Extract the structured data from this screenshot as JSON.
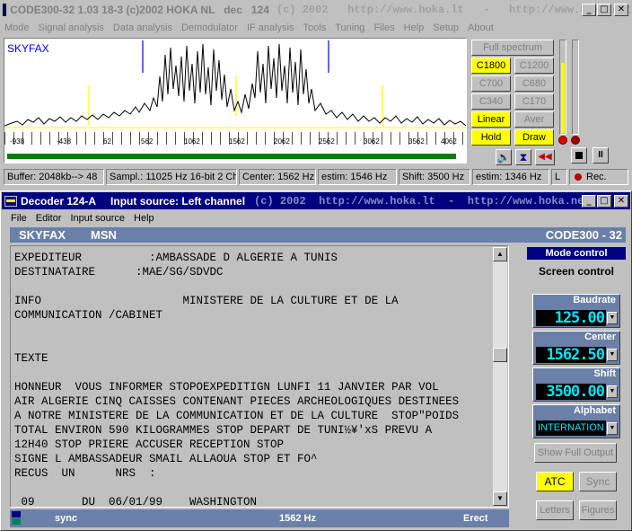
{
  "top_window": {
    "title": "CODE300-32 1.03 18-3 (c)2002 HOKA NL   dec   124",
    "title_watermark": "(c) 2002   http://www.hoka.lt   -   http://www.hoka.net",
    "menu": [
      "Mode",
      "Signal analysis",
      "Data analysis",
      "Demodulator",
      "IF analysis",
      "Tools",
      "Tuning",
      "Files",
      "Help",
      "Setup",
      "About"
    ],
    "spectrum_label": "SKYFAX",
    "x_ticks": [
      "-938",
      "-438",
      "62",
      "562",
      "1062",
      "1562",
      "2062",
      "2562",
      "3062",
      "3562",
      "4062"
    ],
    "buttons": {
      "full_spectrum": "Full spectrum",
      "c1800": "C1800",
      "c1200": "C1200",
      "c700": "C700",
      "c680": "C680",
      "c340": "C340",
      "c170": "C170",
      "linear": "Linear",
      "aver": "Aver",
      "hold": "Hold",
      "draw": "Draw"
    },
    "status": {
      "buffer": "Buffer: 2048kb--> 48",
      "sampl": "Sampl.: 11025 Hz 16-bit 2 Ch",
      "center": "Center: 1562 Hz",
      "estim1": "estim: 1546 Hz",
      "shift": "Shift: 3500 Hz",
      "estim2": "estim: 1346 Hz",
      "channel": "L",
      "rec": "Rec."
    }
  },
  "decoder_window": {
    "title": "Decoder 124-A",
    "input_source_title": "Input source: Left channel",
    "title_watermark": "(c) 2002  http://www.hoka.lt  -  http://www.hoka.net",
    "menu": [
      "File",
      "Editor",
      "Input source",
      "Help"
    ],
    "header_left": "SKYFAX",
    "header_mid": "MSN",
    "header_right": "CODE300 - 32",
    "text_lines": [
      "EXPEDITEUR          :AMBASSADE D ALGERIE A TUNIS",
      "DESTINATAIRE      :MAE/SG/SDVDC",
      "",
      "INFO                     MINISTERE DE LA CULTURE ET DE LA",
      "COMMUNICATION /CABINET",
      "",
      "",
      "TEXTE",
      "",
      "HONNEUR  VOUS INFORMER STOPOEXPEDITIGN LUNFI 11 JANVIER PAR VOL",
      "AIR ALGERIE CINQ CAISSES CONTENANT PIECES ARCHEOLOGIQUES DESTINEES",
      "A NOTRE MINISTERE DE LA COMMUNICATION ET DE LA CULTURE  STOP\"POIDS",
      "TOTAL ENVIRON 590 KILOGRAMMES STOP DEPART DE TUNI½¥'xS PREVU A",
      "12H40 STOP PRIERE ACCUSER RECEPTION STOP",
      "SIGNE L AMBASSADEUR SMAIL ALLAOUA STOP ET FO^",
      "RECUS  UN      NRS  :",
      "",
      " 09       DU  06/01/99    WASHINGTON"
    ],
    "right_panel": {
      "mode_control": "Mode control",
      "screen_control": "Screen control",
      "baudrate_label": "Baudrate",
      "baudrate_value": "125.00",
      "center_label": "Center",
      "center_value": "1562.50",
      "shift_label": "Shift",
      "shift_value": "3500.00",
      "alphabet_label": "Alphabet",
      "alphabet_value": "INTERNATION",
      "show_full_output": "Show Full Output",
      "atc": "ATC",
      "sync": "Sync",
      "letters": "Letters",
      "figures": "Figures"
    },
    "status": {
      "sync": "sync",
      "freq": "1562 Hz",
      "mode": "Erect"
    }
  },
  "colors": {
    "title_active": "#000080",
    "watermark": "#808080",
    "lcd_text": "#00e5ff",
    "panel_blue": "#6b80a8",
    "yellow": "#ffff00"
  }
}
